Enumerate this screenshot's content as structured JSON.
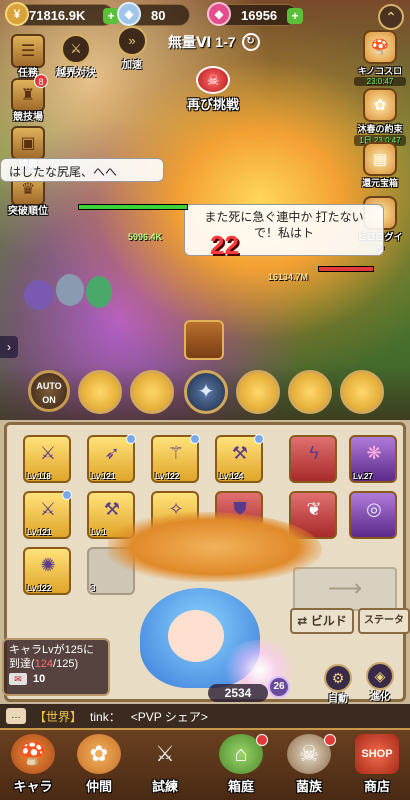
{
  "resources": {
    "gold": "71816.9K",
    "gems": "80",
    "rubies": "16956"
  },
  "stage": {
    "name": "無量Ⅵ 1-7"
  },
  "left_menu": [
    {
      "label": "任務",
      "icon": "scroll-icon"
    },
    {
      "label": "競技場",
      "icon": "trophy-icon",
      "badge": "8"
    },
    {
      "label": "特典",
      "icon": "gift-icon"
    },
    {
      "label": "突破順位",
      "icon": "rank-icon"
    }
  ],
  "mid_menu": [
    {
      "label": "越界対決",
      "icon": "versus-icon"
    },
    {
      "label": "加速",
      "icon": "speed-icon"
    }
  ],
  "right_menu": [
    {
      "label": "キノコスロ",
      "timer": "23:0:47",
      "icon": "mushroom-icon"
    },
    {
      "label": "沐春の約束",
      "timer": "1日 23:0:47",
      "icon": "spring-icon"
    },
    {
      "label": "還元宝箱",
      "icon": "chest-icon"
    },
    {
      "label": "ヒロログイン",
      "icon": "login-icon"
    }
  ],
  "retry": {
    "label": "再び挑戦"
  },
  "bubbles": {
    "left": "はしたな尻尾、へへ",
    "right": "また死に急ぐ連中か 打たないで！私はト"
  },
  "battle": {
    "ally_hp_text": "5996.4K",
    "enemy_hp_text": "16134.7M",
    "big_damage": "22"
  },
  "auto": {
    "label": "AUTO ON"
  },
  "equipment": [
    {
      "lv": "Lv.118"
    },
    {
      "lv": "Lv.121"
    },
    {
      "lv": "Lv.122"
    },
    {
      "lv": "Lv.124"
    },
    {
      "lv": "Lv.121"
    },
    {
      "lv": "Lv.1"
    },
    {
      "lv": ""
    },
    {
      "lv": ""
    },
    {
      "lv": "Lv.122"
    },
    {
      "lv": "3"
    }
  ],
  "side_equipment": [
    {
      "lv": ""
    },
    {
      "lv": "Lv.27"
    },
    {
      "lv": ""
    },
    {
      "lv": ""
    }
  ],
  "buttons": {
    "build": "ビルド",
    "status": "ステータス",
    "auto_label": "自動",
    "evolve": "進化"
  },
  "hero": {
    "power": "2534",
    "level": "26"
  },
  "mission": {
    "line1": "キャラLvが125に",
    "line2_prefix": "到達(",
    "progress": "124",
    "line2_suffix": "/125)",
    "reward": "10"
  },
  "chat": {
    "channel": "【世界】",
    "name": "tink：",
    "message": "<PVP シェア>"
  },
  "nav": [
    {
      "label": "キャラ",
      "icon": "mushroom-icon"
    },
    {
      "label": "仲間",
      "icon": "paw-icon"
    },
    {
      "label": "試練",
      "icon": "crossed-swords-icon"
    },
    {
      "label": "箱庭",
      "icon": "house-icon"
    },
    {
      "label": "菌族",
      "icon": "skull-icon"
    },
    {
      "label": "商店",
      "icon": "shop-icon"
    }
  ],
  "colors": {
    "accent": "#d8b064",
    "alert": "#e23a3a",
    "panel": "#e9dcc4"
  }
}
